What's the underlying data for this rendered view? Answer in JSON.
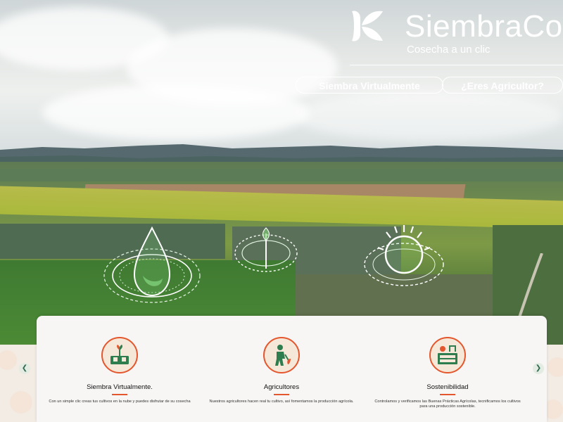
{
  "brand": {
    "name": "SiembraCo",
    "tagline": "Cosecha a un clic"
  },
  "hero": {
    "buttons": [
      {
        "label": "Siembra Virtualmente"
      },
      {
        "label": "¿Eres Agricultor?"
      }
    ]
  },
  "features": [
    {
      "icon": "virtual-planting-icon",
      "title": "Siembra Virtualmente.",
      "description": "Con un simple clic creas tus cultivos en la nube y puedes disfrutar de su cosecha"
    },
    {
      "icon": "farmer-icon",
      "title": "Agricultores",
      "description": "Nuestros agricultores hacen real tu cultivo, así fomentamos la producción agrícola."
    },
    {
      "icon": "sustainability-icon",
      "title": "Sostenibilidad",
      "description": "Controlamos y verificamos las Buenas Prácticas Agrícolas, tecnificamos los cultivos para una producción sostenible."
    }
  ],
  "carousel": {
    "prev_icon": "chevron-left-icon",
    "next_icon": "chevron-right-icon"
  },
  "colors": {
    "accent": "#e4572e",
    "nav_green": "#2f6b4c",
    "icon_green": "#2e7d4f"
  }
}
